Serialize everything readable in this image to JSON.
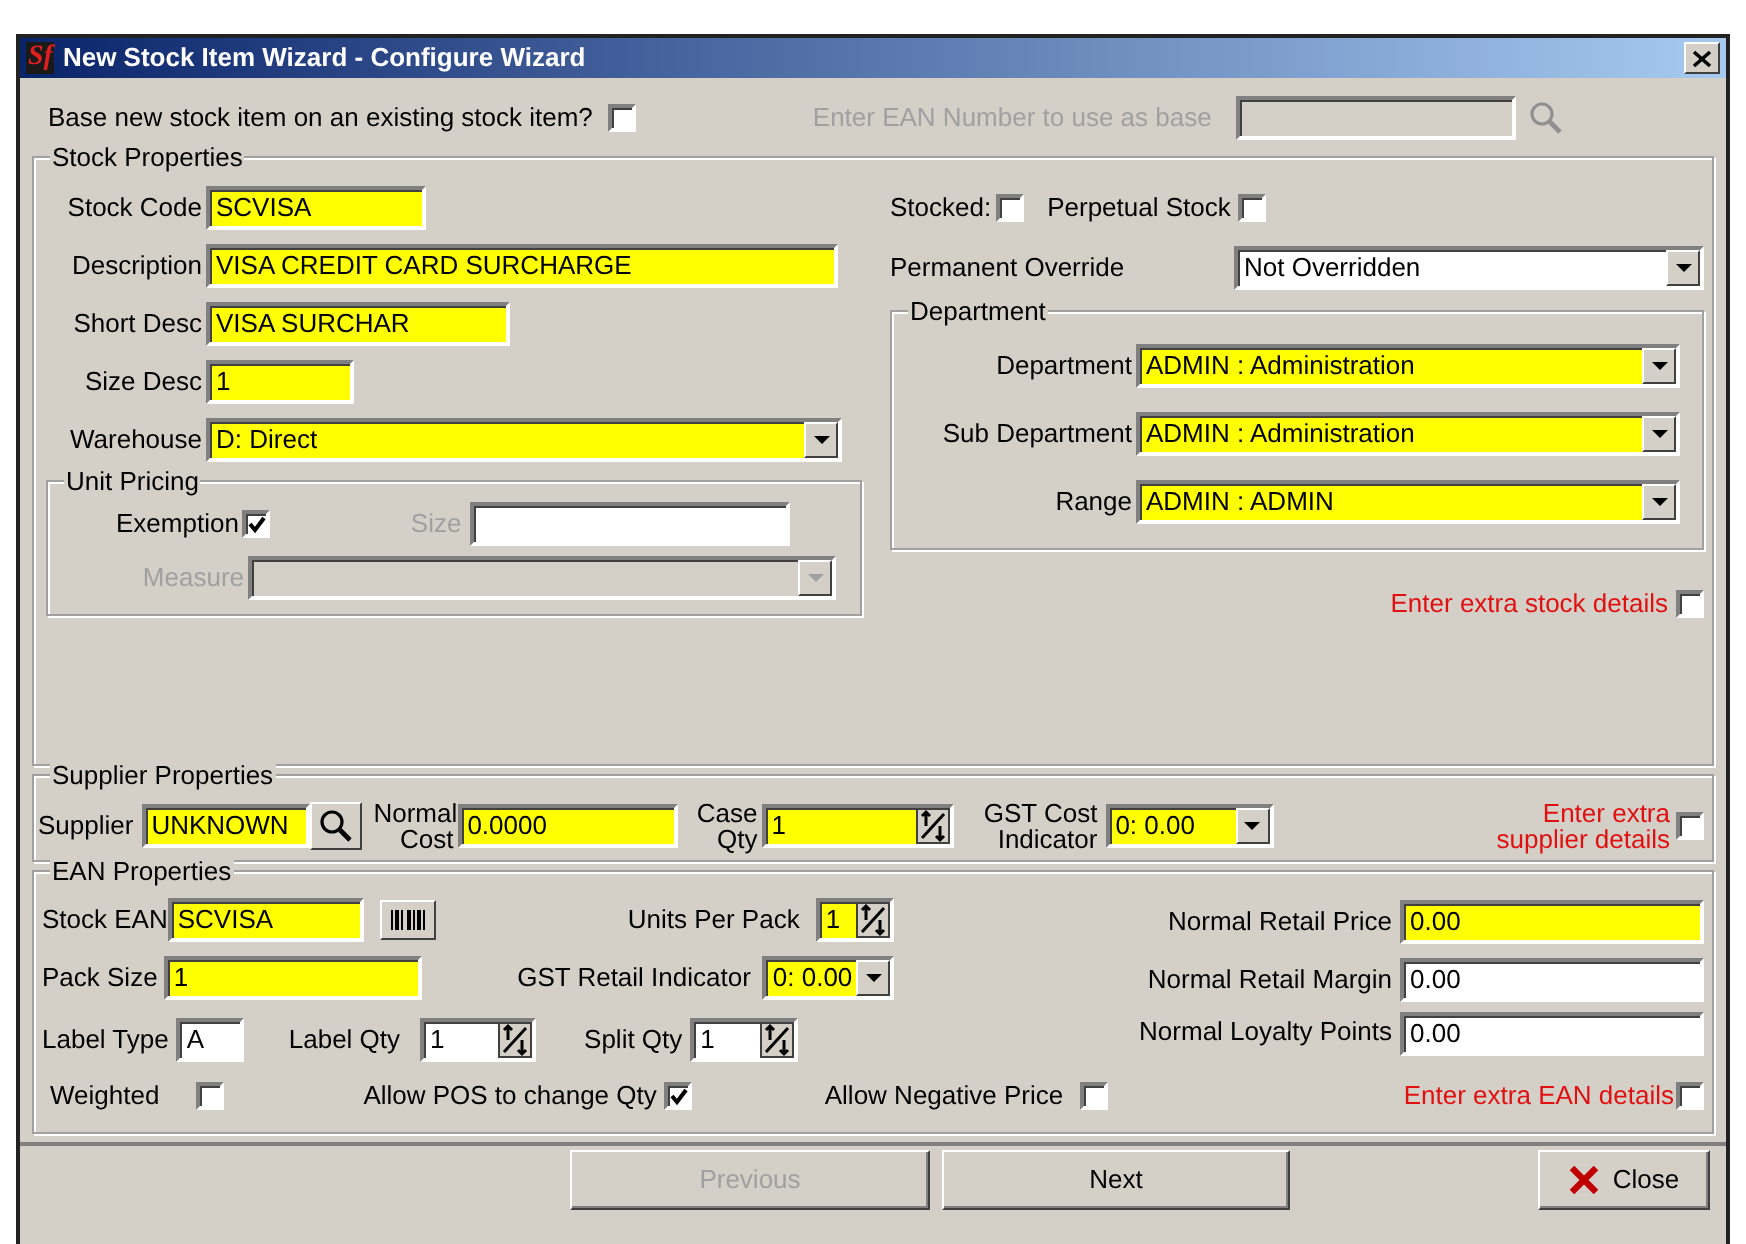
{
  "window": {
    "logo": "Sf",
    "title": "New Stock Item Wizard - Configure Wizard"
  },
  "base_item": {
    "label": "Base new stock item on an existing stock item?",
    "checked": false
  },
  "base_ean": {
    "label": "Enter EAN Number to use as base",
    "disabled": true
  },
  "stock_properties": {
    "title": "Stock Properties",
    "fields": [
      {
        "kind": "text",
        "label": "Stock Code",
        "value": "SCVISA",
        "required": true
      },
      {
        "kind": "text",
        "label": "Description",
        "value": "VISA CREDIT CARD SURCHARGE",
        "required": true
      },
      {
        "kind": "text",
        "label": "Short Desc",
        "value": "VISA SURCHAR",
        "required": true
      },
      {
        "kind": "text",
        "label": "Size Desc",
        "value": "1",
        "required": true
      },
      {
        "kind": "select",
        "label": "Warehouse",
        "value": "D: Direct",
        "required": true
      }
    ],
    "unit_pricing": {
      "title": "Unit Pricing",
      "exemption": {
        "label": "Exemption",
        "checked": true
      },
      "size": {
        "label": "Size",
        "disabled": true
      },
      "measure": {
        "label": "Measure",
        "disabled": true
      }
    },
    "stocked": {
      "label": "Stocked:",
      "checked": false
    },
    "perpetual": {
      "label": "Perpetual Stock",
      "checked": false
    },
    "override": {
      "label": "Permanent Override",
      "value": "Not Overridden",
      "required": false
    },
    "department": {
      "title": "Department",
      "fields": [
        {
          "label": "Department",
          "value": "ADMIN : Administration",
          "required": true
        },
        {
          "label": "Sub Department",
          "value": "ADMIN : Administration",
          "required": true
        },
        {
          "label": "Range",
          "value": "ADMIN : ADMIN",
          "required": true
        }
      ]
    },
    "extra": {
      "label": "Enter extra stock details",
      "checked": false
    }
  },
  "supplier_properties": {
    "title": "Supplier Properties",
    "supplier": {
      "label": "Supplier",
      "value": "UNKNOWN",
      "required": true
    },
    "normal_cost": {
      "label": "Normal Cost",
      "value": "0.0000",
      "required": true
    },
    "case_qty": {
      "label": "Case Qty",
      "value": "1",
      "required": true
    },
    "gst_cost": {
      "label": "GST Cost Indicator",
      "value": "0: 0.00",
      "required": true
    },
    "extra": {
      "label": "Enter extra supplier details",
      "checked": false
    }
  },
  "ean_properties": {
    "title": "EAN Properties",
    "stock_ean": {
      "label": "Stock EAN",
      "value": "SCVISA",
      "required": true
    },
    "pack_size": {
      "label": "Pack Size",
      "value": "1",
      "required": true
    },
    "units_per_pack": {
      "label": "Units Per Pack",
      "value": "1",
      "required": true
    },
    "gst_retail": {
      "label": "GST Retail Indicator",
      "value": "0: 0.00",
      "required": true
    },
    "retail_price": {
      "label": "Normal Retail Price",
      "value": "0.00",
      "required": true
    },
    "retail_margin": {
      "label": "Normal Retail Margin",
      "value": "0.00",
      "required": false
    },
    "loyalty_points": {
      "label": "Normal Loyalty Points",
      "value": "0.00",
      "required": false
    },
    "label_type": {
      "label": "Label Type",
      "value": "A",
      "required": false
    },
    "label_qty": {
      "label": "Label Qty",
      "value": "1",
      "required": false
    },
    "split_qty": {
      "label": "Split Qty",
      "value": "1",
      "required": false
    },
    "weighted": {
      "label": "Weighted",
      "checked": false
    },
    "allow_pos": {
      "label": "Allow POS to change Qty",
      "checked": true
    },
    "allow_negative": {
      "label": "Allow Negative Price",
      "checked": false
    },
    "extra": {
      "label": "Enter extra EAN details",
      "checked": false
    }
  },
  "buttons": [
    {
      "kind": "nav",
      "label": "Previous",
      "disabled": true
    },
    {
      "kind": "nav",
      "label": "Next",
      "disabled": false
    },
    {
      "kind": "close",
      "label": "Close",
      "disabled": false
    }
  ]
}
